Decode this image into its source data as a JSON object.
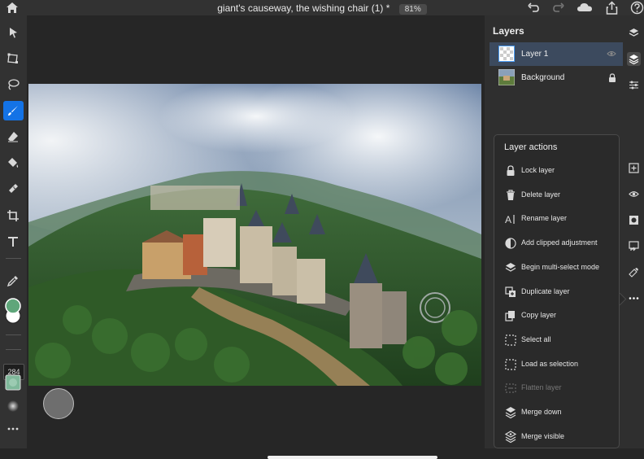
{
  "document": {
    "title": "giant's causeway, the wishing chair (1) *",
    "zoom": "81%"
  },
  "toolbar": {
    "brush_size": "284",
    "tools": [
      "move-tool",
      "transform-tool",
      "lasso-tool",
      "brush-tool",
      "eraser-tool",
      "fill-tool",
      "healing-tool",
      "crop-tool",
      "type-tool",
      "eyedropper-tool"
    ],
    "active_tool": "brush-tool",
    "primary_color": "#5fa67a",
    "secondary_color": "#ffffff"
  },
  "layers_panel": {
    "title": "Layers",
    "layers": [
      {
        "name": "Layer 1",
        "selected": true,
        "status_icon": "eye-icon"
      },
      {
        "name": "Background",
        "selected": false,
        "status_icon": "lock-icon"
      }
    ]
  },
  "layer_actions": {
    "title": "Layer actions",
    "items": [
      {
        "label": "Lock layer",
        "icon": "lock-icon"
      },
      {
        "label": "Delete layer",
        "icon": "trash-icon"
      },
      {
        "label": "Rename layer",
        "icon": "rename-icon"
      },
      {
        "label": "Add clipped adjustment",
        "icon": "adjustment-icon"
      },
      {
        "label": "Begin multi-select mode",
        "icon": "layers-icon"
      },
      {
        "label": "Duplicate layer",
        "icon": "duplicate-icon"
      },
      {
        "label": "Copy layer",
        "icon": "copy-icon"
      },
      {
        "label": "Select all",
        "icon": "marquee-icon"
      },
      {
        "label": "Load as selection",
        "icon": "marquee-icon"
      },
      {
        "label": "Flatten layer",
        "icon": "flatten-icon",
        "disabled": true
      },
      {
        "label": "Merge down",
        "icon": "merge-down-icon"
      },
      {
        "label": "Merge visible",
        "icon": "merge-visible-icon"
      }
    ]
  },
  "colors": {
    "accent": "#1473e6",
    "panel_bg": "#2f2f2f",
    "canvas_bg": "#262626"
  }
}
